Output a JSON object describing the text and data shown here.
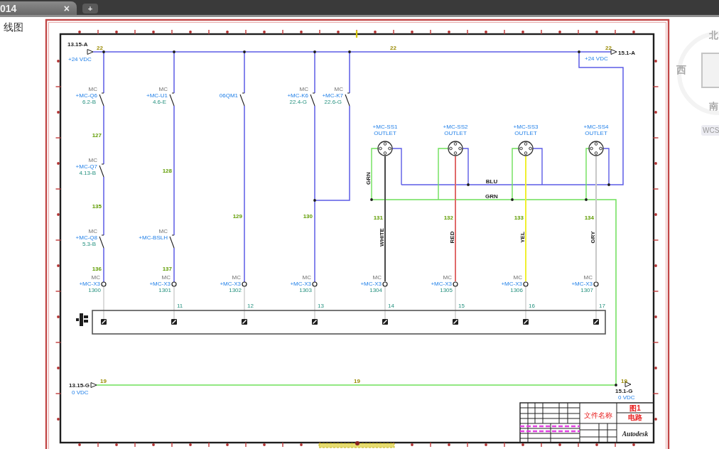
{
  "tab_bar": {
    "tabs": [
      {
        "label": "014",
        "selected": true,
        "close_label": "×"
      }
    ],
    "new_tab_label": "+"
  },
  "drawing_name": "线图",
  "schematic": {
    "top_bus": {
      "left_ref": "13.15-A",
      "left_voltage": "+24 VDC",
      "right_ref": "15.1-A",
      "right_voltage": "+24 VDC",
      "wire_numbers": [
        "22",
        "22",
        "22"
      ]
    },
    "rungs": [
      {
        "items": [
          {
            "kind": "contact",
            "mfr": "MC",
            "tag": "+MC-Q6",
            "ref": "6.2-B"
          },
          {
            "kind": "wire_number",
            "text": "127"
          },
          {
            "kind": "contact",
            "mfr": "MC",
            "tag": "+MC-Q7",
            "ref": "4.13-B"
          },
          {
            "kind": "wire_number",
            "text": "135"
          },
          {
            "kind": "contact",
            "mfr": "MC",
            "tag": "+MC-Q8",
            "ref": "5.3-B"
          },
          {
            "kind": "wire_number",
            "text": "136"
          }
        ],
        "terminal": {
          "mfr": "MC",
          "tag": "+MC-X3",
          "number": "1300"
        }
      },
      {
        "items": [
          {
            "kind": "contact",
            "mfr": "MC",
            "tag": "+MC-U1",
            "ref": "4.6-E"
          },
          {
            "kind": "wire_number",
            "text": "128"
          },
          {
            "kind": "contact",
            "mfr": "MC",
            "tag": "+MC-BSLH"
          },
          {
            "kind": "wire_number",
            "text": "137"
          }
        ],
        "terminal": {
          "mfr": "MC",
          "tag": "+MC-X3",
          "number": "1301",
          "strip_number": "11"
        }
      },
      {
        "items": [
          {
            "kind": "contact",
            "tag": "06QM1"
          },
          {
            "kind": "wire_number",
            "text": "129"
          }
        ],
        "terminal": {
          "mfr": "MC",
          "tag": "+MC-X3",
          "number": "1302",
          "strip_number": "12"
        }
      },
      {
        "items": [
          {
            "kind": "contact",
            "mfr": "MC",
            "tag": "+MC-K6",
            "ref": "22.4-G"
          },
          {
            "kind": "wire_number",
            "text": "130"
          }
        ],
        "terminal": {
          "mfr": "MC",
          "tag": "+MC-X3",
          "number": "1303",
          "strip_number": "13"
        }
      },
      {
        "items": [
          {
            "kind": "contact",
            "mfr": "MC",
            "tag": "+MC-K7",
            "ref": "22.6-G"
          }
        ]
      }
    ],
    "outlets": [
      {
        "tag": "+MC-SS1",
        "type": "OUTLET",
        "wire_number": "131",
        "wire_label": "WHITE",
        "color": "#4a4a4a",
        "terminal": {
          "mfr": "MC",
          "tag": "+MC-X3",
          "number": "1304",
          "strip_number": "14"
        }
      },
      {
        "tag": "+MC-SS2",
        "type": "OUTLET",
        "wire_number": "132",
        "wire_label": "RED",
        "color": "#e06a6a",
        "terminal": {
          "mfr": "MC",
          "tag": "+MC-X3",
          "number": "1305",
          "strip_number": "15"
        }
      },
      {
        "tag": "+MC-SS3",
        "type": "OUTLET",
        "wire_number": "133",
        "wire_label": "YEL",
        "color": "#f0f030",
        "terminal": {
          "mfr": "MC",
          "tag": "+MC-X3",
          "number": "1306",
          "strip_number": "16"
        }
      },
      {
        "tag": "+MC-SS4",
        "type": "OUTLET",
        "wire_number": "134",
        "wire_label": "GRY",
        "color": "#c8c8c8",
        "terminal": {
          "mfr": "MC",
          "tag": "+MC-X3",
          "number": "1307",
          "strip_number": "17"
        }
      }
    ],
    "bus_labels": {
      "blue_bus": "BLU",
      "green_bus": "GRN",
      "green_riser": "GRN"
    },
    "bottom_bus": {
      "left_ref": "13.15-G",
      "left_voltage": "0 VDC",
      "right_ref": "15.1-G",
      "right_voltage": "0 VDC",
      "wire_numbers": [
        "19",
        "19",
        "19"
      ]
    },
    "title_block": {
      "file_name_label": "文件名称",
      "title_lines": [
        "图1",
        "电路"
      ],
      "company": "Autodesk"
    }
  },
  "view_cube": {
    "north": "北",
    "west": "西",
    "south": "南",
    "coordinate_system": "WCS"
  }
}
